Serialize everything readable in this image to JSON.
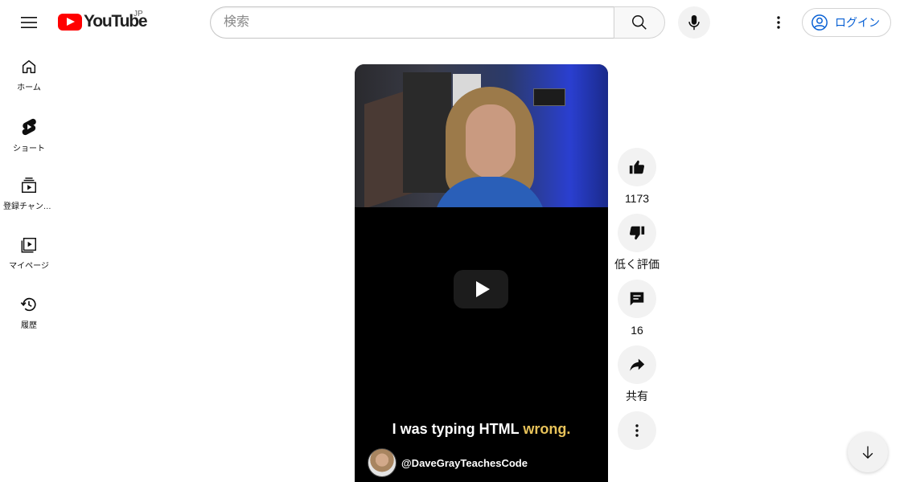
{
  "header": {
    "logo_text": "YouTube",
    "country_code": "JP",
    "search_placeholder": "検索",
    "login_label": "ログイン"
  },
  "sidebar": {
    "items": [
      {
        "label": "ホーム",
        "icon": "home-icon"
      },
      {
        "label": "ショート",
        "icon": "shorts-icon"
      },
      {
        "label": "登録チャンネル",
        "icon": "subscriptions-icon"
      },
      {
        "label": "マイページ",
        "icon": "library-icon"
      },
      {
        "label": "履歴",
        "icon": "history-icon"
      }
    ]
  },
  "video": {
    "caption_main": "I was typing HTML ",
    "caption_highlight": "wrong.",
    "channel_handle": "@DaveGrayTeachesCode"
  },
  "actions": {
    "like_count": "1173",
    "dislike_label": "低く評価",
    "comment_count": "16",
    "share_label": "共有"
  },
  "colors": {
    "brand_red": "#ff0000",
    "link_blue": "#065fd4",
    "caption_highlight": "#e8c35a"
  }
}
